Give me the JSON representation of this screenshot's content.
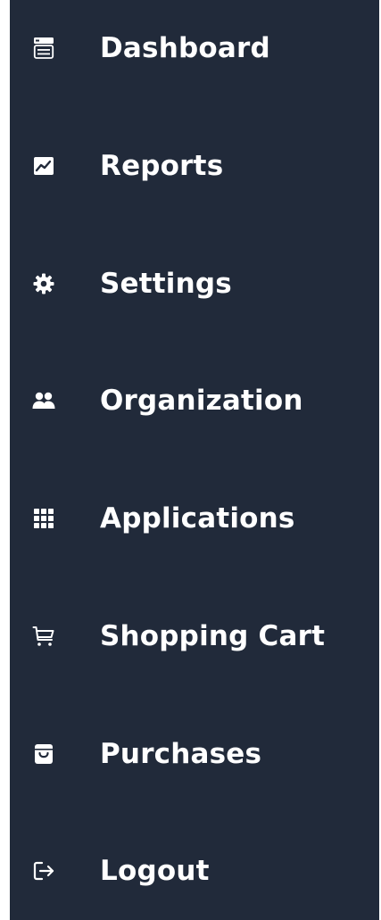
{
  "sidebar": {
    "background": "#212a3a",
    "text_color": "#ffffff",
    "items": [
      {
        "label": "Dashboard",
        "icon": "dashboard-icon"
      },
      {
        "label": "Reports",
        "icon": "chart-icon"
      },
      {
        "label": "Settings",
        "icon": "gear-icon"
      },
      {
        "label": "Organization",
        "icon": "users-icon"
      },
      {
        "label": "Applications",
        "icon": "apps-grid-icon"
      },
      {
        "label": "Shopping Cart",
        "icon": "cart-icon"
      },
      {
        "label": "Purchases",
        "icon": "bag-icon"
      },
      {
        "label": "Logout",
        "icon": "logout-icon"
      }
    ]
  }
}
